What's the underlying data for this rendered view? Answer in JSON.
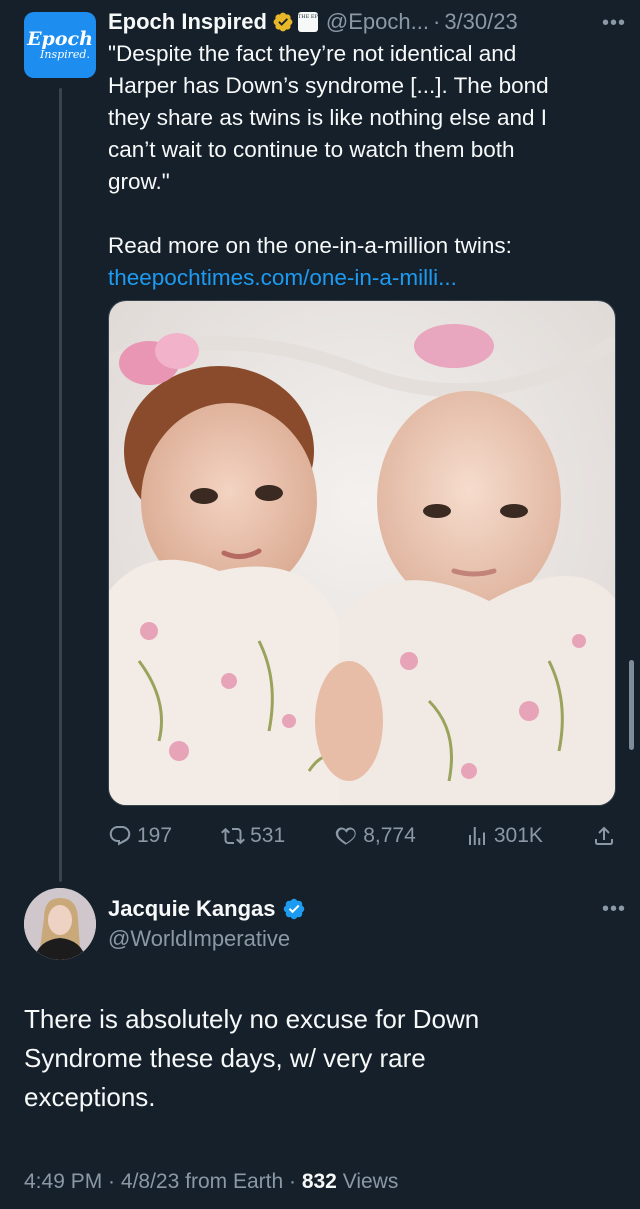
{
  "tweet1": {
    "avatar": {
      "line1": "Epoch",
      "line2": "Inspired."
    },
    "display_name": "Epoch Inspired",
    "org_badge_text": "THE EPOCH TIMES",
    "handle": "@Epoch...",
    "separator": "·",
    "date": "3/30/23",
    "more_label": "•••",
    "body_lines": [
      "\"Despite the fact they’re not identical and",
      "Harper has Down’s syndrome [...]. The bond",
      "they share as twins is like nothing else and I",
      "can’t wait to continue to watch them both",
      "grow.\""
    ],
    "read_more": "Read more on the one-in-a-million twins:",
    "link": "theepochtimes.com/one-in-a-milli...",
    "stats": {
      "replies": "197",
      "retweets": "531",
      "likes": "8,774",
      "views": "301K"
    },
    "verified_color": "#e8b829"
  },
  "tweet2": {
    "display_name": "Jacquie Kangas",
    "handle": "@WorldImperative",
    "more_label": "•••",
    "body_lines": [
      "There is absolutely no excuse for Down",
      "Syndrome these days, w/ very rare",
      "exceptions."
    ],
    "meta": {
      "time": "4:49 PM",
      "sep1": " · ",
      "date": "4/8/23",
      "source": " from Earth",
      "sep2": " · ",
      "views_count": "832",
      "views_label": " Views"
    },
    "verified_color": "#1d9bf0"
  },
  "icons": [
    "reply-icon",
    "retweet-icon",
    "like-icon",
    "views-icon",
    "share-icon",
    "more-icon",
    "verified-icon"
  ]
}
